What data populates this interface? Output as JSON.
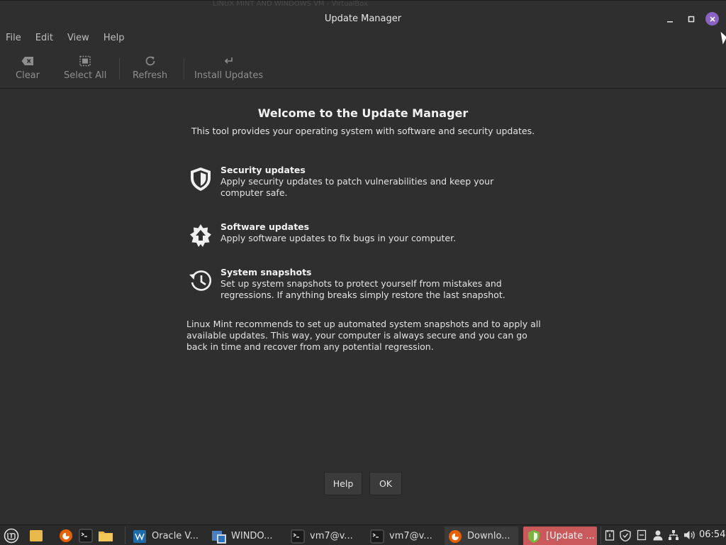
{
  "window": {
    "title": "Update Manager",
    "ghost_title": "LINUX MINT AND WINDOWS VM - VirtualBox"
  },
  "menubar": {
    "items": [
      "File",
      "Edit",
      "View",
      "Help"
    ]
  },
  "toolbar": {
    "clear": "Clear",
    "select_all": "Select All",
    "refresh": "Refresh",
    "install": "Install Updates"
  },
  "welcome": {
    "title": "Welcome to the Update Manager",
    "subtitle": "This tool provides your operating system with software and security updates."
  },
  "features": [
    {
      "title": "Security updates",
      "desc": "Apply security updates to patch vulnerabilities and keep your computer safe.",
      "icon": "shield-icon"
    },
    {
      "title": "Software updates",
      "desc": "Apply software updates to fix bugs in your computer.",
      "icon": "update-star-icon"
    },
    {
      "title": "System snapshots",
      "desc": "Set up system snapshots to protect yourself from mistakes and regressions. If anything breaks simply restore the last snapshot.",
      "icon": "history-icon"
    }
  ],
  "recommendation": "Linux Mint recommends to set up automated system snapshots and to apply all available updates. This way, your computer is always secure and you can go back in time and recover from any potential regression.",
  "dialog_buttons": {
    "help": "Help",
    "ok": "OK"
  },
  "taskbar": {
    "tasks": [
      "Oracle V...",
      "WINDO...",
      "vm7@v...",
      "vm7@v...",
      "Downlo...",
      "[Update ..."
    ],
    "clock": "06:54",
    "colors": {
      "active_task": "#c9595b",
      "mint": "#8bc34a",
      "firefox": "#e66000"
    }
  }
}
